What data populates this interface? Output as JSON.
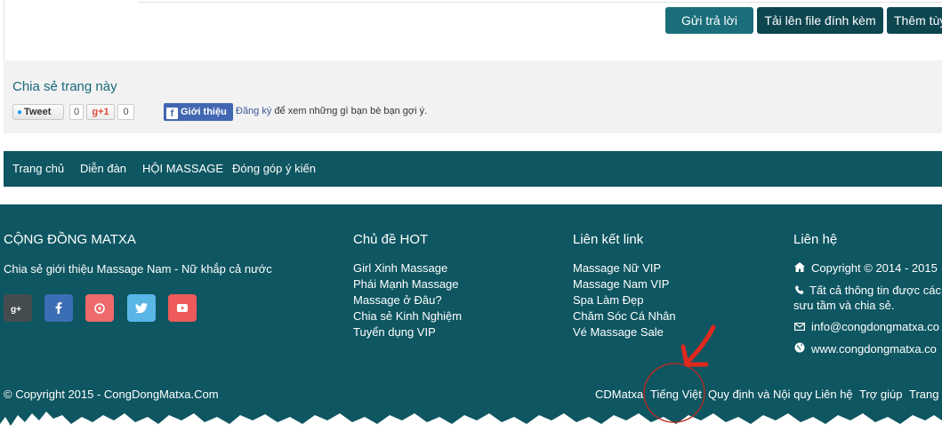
{
  "editor_toolbar": {
    "reply_button": "Gửi trả lời",
    "upload_button": "Tải lên file đính kèm",
    "more_button": "Thêm tùy"
  },
  "share": {
    "title": "Chia sẻ trang này",
    "tweet_label": "Tweet",
    "tweet_count": "0",
    "gplus_label": "g+1",
    "gplus_count": "0",
    "fb_label": "Giới thiệu",
    "fb_signup_link": "Đăng ký",
    "fb_text": " để xem những gì bạn bè bạn gợi ý."
  },
  "nav": {
    "items": [
      "Trang chủ",
      "Diễn đàn",
      "HỘI MASSAGE",
      "Đóng góp ý kiến"
    ]
  },
  "footer": {
    "about": {
      "title": "CỘNG ĐỒNG MATXA",
      "description": "Chia sẻ giới thiệu Massage Nam - Nữ khắp cả nước",
      "social_icons": [
        "google-plus-icon",
        "facebook-icon",
        "pinterest-icon",
        "twitter-icon",
        "youtube-icon"
      ]
    },
    "hot_topics": {
      "title": "Chủ đề HOT",
      "items": [
        "Girl Xinh Massage",
        "Phái Mạnh Massage",
        "Massage ở Đâu?",
        "Chia sẻ Kinh Nghiệm",
        "Tuyển dụng VIP"
      ]
    },
    "links": {
      "title": "Liên kết link",
      "items": [
        "Massage Nữ VIP",
        "Massage Nam VIP",
        "Spa Làm Đẹp",
        "Chăm Sóc Cá Nhân",
        "Vé Massage Sale"
      ]
    },
    "contact": {
      "title": "Liên hệ",
      "copyright": "Copyright © 2014 - 2015",
      "info_line1": "Tất cả thông tin được các",
      "info_line2": "sưu tầm và chia sẻ.",
      "email": "info@congdongmatxa.co",
      "website": "www.congdongmatxa.co"
    },
    "copyright": "© Copyright 2015 - CongDongMatxa.Com",
    "bottom_links": [
      "CDMatxa",
      "Tiếng Việt",
      "Quy định và Nội quy",
      "Liên hệ",
      "Trợ giúp",
      "Trang"
    ]
  },
  "colors": {
    "teal_dark": "#0e5661",
    "button_teal": "#1a6e7b",
    "annotation_red": "#c0281e"
  }
}
